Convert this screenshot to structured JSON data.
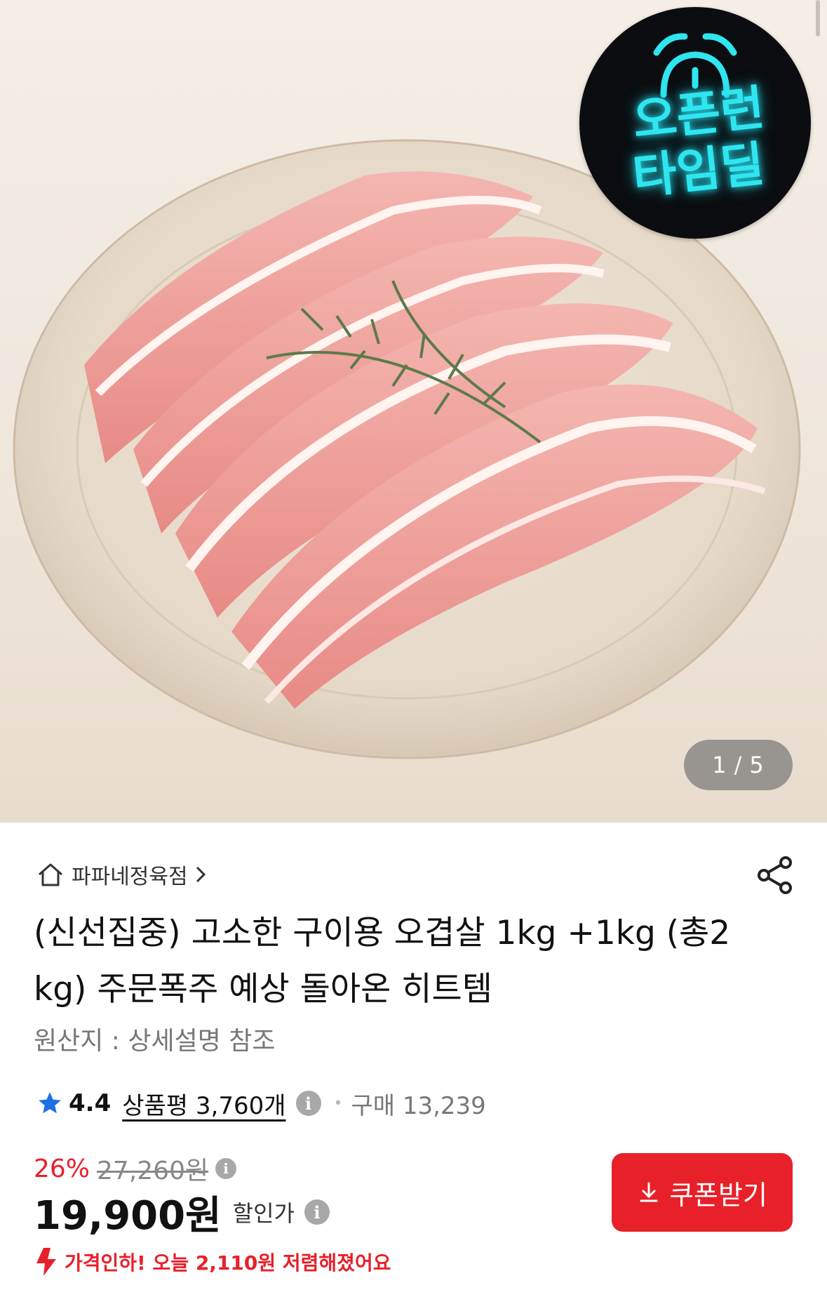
{
  "gallery": {
    "current": "1",
    "separator": "/",
    "total": "5",
    "badge_line1": "오픈런",
    "badge_line2": "타임딜"
  },
  "store": {
    "name": "파파네정육점"
  },
  "product": {
    "title": "(신선집중) 고소한 구이용 오겹살 1kg +1kg (총2kg) 주문폭주 예상 돌아온 히트템",
    "origin": "원산지 : 상세설명 참조"
  },
  "rating": {
    "score": "4.4",
    "reviews": "상품평 3,760개",
    "purchases": "구매 13,239"
  },
  "price": {
    "discount_pct": "26%",
    "original": "27,260원",
    "current": "19,900원",
    "label": "할인가"
  },
  "coupon": {
    "label": "쿠폰받기"
  },
  "promo": {
    "text": "가격인하! 오늘 2,110원 저렴해졌어요"
  },
  "colors": {
    "accent_red": "#e8202a",
    "badge_neon": "#2fe6f0",
    "star_blue": "#1e6fe6"
  }
}
